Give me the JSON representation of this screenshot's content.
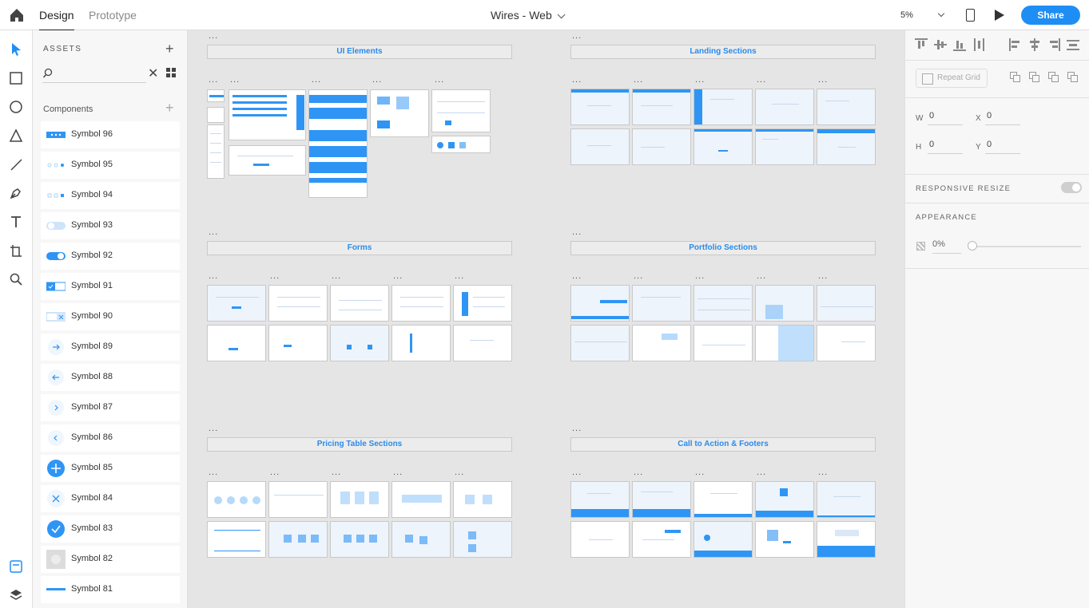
{
  "topbar": {
    "tabs": [
      "Design",
      "Prototype"
    ],
    "doc_title": "Wires - Web",
    "zoom": "5%",
    "share": "Share"
  },
  "assets": {
    "title": "ASSETS",
    "search_placeholder": "",
    "components_label": "Components",
    "symbols": [
      "Symbol 96",
      "Symbol 95",
      "Symbol 94",
      "Symbol 93",
      "Symbol 92",
      "Symbol 91",
      "Symbol 90",
      "Symbol 89",
      "Symbol 88",
      "Symbol 87",
      "Symbol 86",
      "Symbol 85",
      "Symbol 84",
      "Symbol 83",
      "Symbol 82",
      "Symbol 81"
    ]
  },
  "canvas": {
    "sections": [
      "UI Elements",
      "Landing Sections",
      "Forms",
      "Portfolio Sections",
      "Pricing Table Sections",
      "Call to Action & Footers"
    ],
    "dots": "..."
  },
  "props": {
    "repeat_grid": "Repeat Grid",
    "w_label": "W",
    "w_value": "0",
    "x_label": "X",
    "x_value": "0",
    "h_label": "H",
    "h_value": "0",
    "y_label": "Y",
    "y_value": "0",
    "responsive_resize": "RESPONSIVE RESIZE",
    "appearance": "APPEARANCE",
    "opacity": "0%"
  },
  "colors": {
    "accent": "#1e8ef5",
    "section_title": "#2b8be8"
  }
}
